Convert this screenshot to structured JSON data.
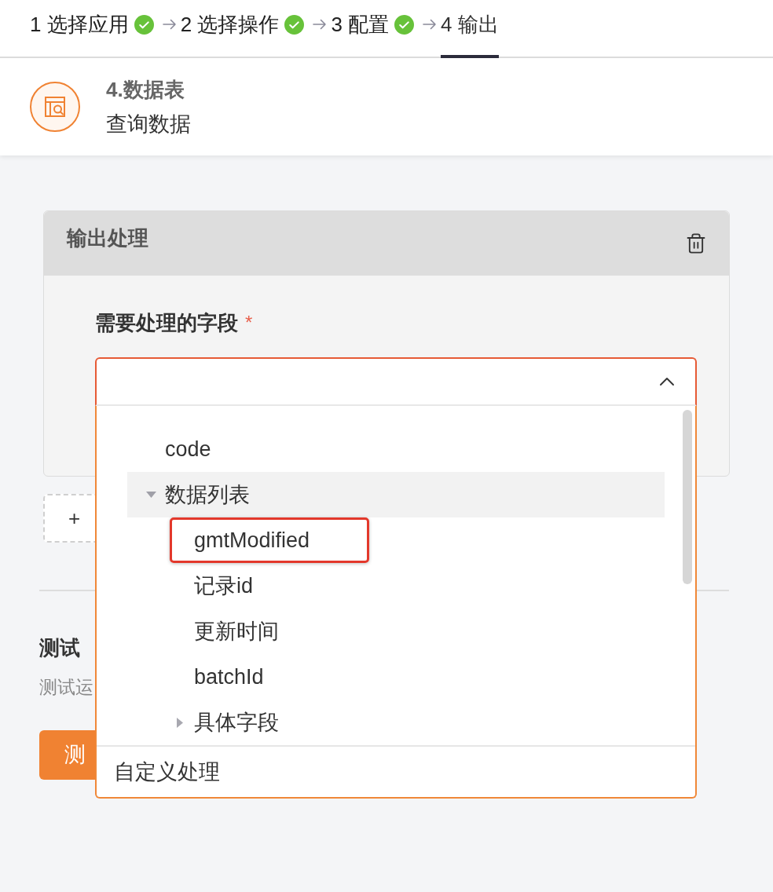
{
  "steps": [
    {
      "label": "1 选择应用",
      "done": true,
      "selected": false
    },
    {
      "label": "2 选择操作",
      "done": true,
      "selected": false
    },
    {
      "label": "3 配置",
      "done": true,
      "selected": false
    },
    {
      "label": "4 输出",
      "done": false,
      "selected": true
    }
  ],
  "node": {
    "title": "4.数据表",
    "subtitle": "查询数据"
  },
  "output_card": {
    "title": "输出处理",
    "field": {
      "label": "需要处理的字段",
      "required_mark": "*",
      "open": true,
      "dropdown": {
        "items": [
          {
            "label": "code",
            "kind": "leaf",
            "selected": false,
            "marked": false
          },
          {
            "label": "数据列表",
            "kind": "group",
            "expanded": true,
            "selected": true,
            "marked": false,
            "children": [
              {
                "label": "gmtModified",
                "kind": "leaf",
                "selected": false,
                "marked": true
              },
              {
                "label": "记录id",
                "kind": "leaf",
                "selected": false,
                "marked": false
              },
              {
                "label": "更新时间",
                "kind": "leaf",
                "selected": false,
                "marked": false
              },
              {
                "label": "batchId",
                "kind": "leaf",
                "selected": false,
                "marked": false
              },
              {
                "label": "具体字段",
                "kind": "group",
                "expanded": false,
                "selected": false,
                "marked": false
              }
            ]
          }
        ],
        "footer_option": "自定义处理"
      }
    }
  },
  "add_button": {
    "label": "+"
  },
  "test": {
    "title": "测试",
    "description": "测试运",
    "button": "测"
  }
}
